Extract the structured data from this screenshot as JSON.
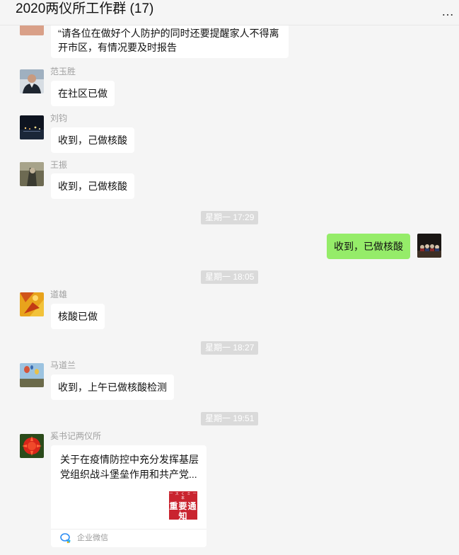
{
  "window": {
    "title": "2020两仪所工作群 (17)",
    "more_label": "…"
  },
  "messages": [
    {
      "lines": [
        "“请各位在做好个人防护的同时还要提醒家人不得离",
        "开市区，有情况要及时报告"
      ]
    },
    {
      "sender": "范玉胜",
      "text": "在社区已做"
    },
    {
      "sender": "刘钧",
      "text": "收到，己做核酸"
    },
    {
      "sender": "王振",
      "text": "收到，己做核酸"
    },
    {
      "time": "星期一 17:29"
    },
    {
      "self": true,
      "text": "收到，已做核酸"
    },
    {
      "time": "星期一 18:05"
    },
    {
      "sender": "道雄",
      "text": "核酸已做"
    },
    {
      "time": "星期一 18:27"
    },
    {
      "sender": "马道兰",
      "text": "收到，上午已做核酸检测"
    },
    {
      "time": "星期一 19:51"
    },
    {
      "sender": "奚书记两仪所",
      "card": {
        "title": "关于在疫情防控中充分发挥基层党组织战斗堡垒作用和共产党...",
        "thumb_top": "一 ス く ミ 一 本",
        "thumb_text": "重要通知",
        "source": "企业微信"
      }
    }
  ],
  "colors": {
    "self_bubble": "#95ec69",
    "other_bubble": "#ffffff",
    "time_badge": "#dadada",
    "background": "#f5f5f5"
  }
}
